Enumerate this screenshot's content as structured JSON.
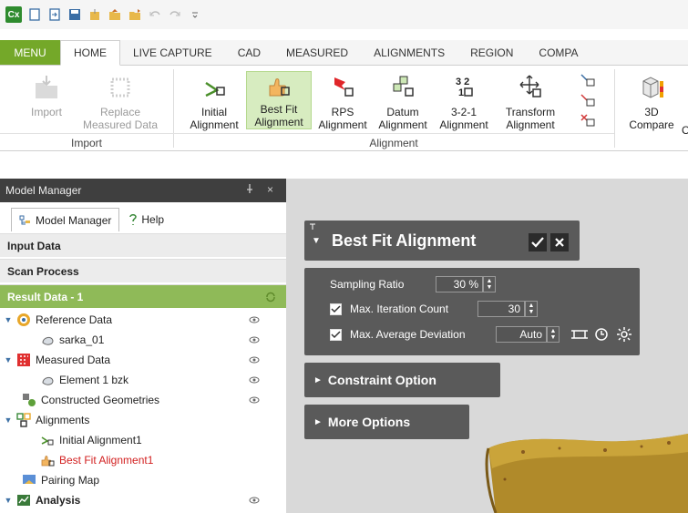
{
  "quick_access": {
    "logo": "Cx",
    "icons": [
      "new-icon",
      "import-icon",
      "save-icon",
      "export-icon",
      "open-icon",
      "open-folder-icon",
      "undo-icon",
      "redo-icon",
      "customize-icon"
    ]
  },
  "tabs": [
    {
      "label": "MENU"
    },
    {
      "label": "HOME"
    },
    {
      "label": "LIVE CAPTURE"
    },
    {
      "label": "CAD"
    },
    {
      "label": "MEASURED"
    },
    {
      "label": "ALIGNMENTS"
    },
    {
      "label": "REGION"
    },
    {
      "label": "COMPA"
    }
  ],
  "ribbon": {
    "import_group": "Import",
    "alignment_group": "Alignment",
    "buttons": {
      "import": "Import",
      "replace_1": "Replace",
      "replace_2": "Measured Data",
      "initial_1": "Initial",
      "initial_2": "Alignment",
      "bestfit_1": "Best Fit",
      "bestfit_2": "Alignment",
      "rps_1": "RPS",
      "rps_2": "Alignment",
      "datum_1": "Datum",
      "datum_2": "Alignment",
      "t321_1": "3-2-1",
      "t321_2": "Alignment",
      "transform_1": "Transform",
      "transform_2": "Alignment",
      "compare_1": "3D",
      "compare_2": "Compare",
      "compare_3": "C"
    }
  },
  "model_manager": {
    "title": "Model Manager",
    "pin": "\u0004",
    "close": "×",
    "tab_model": "Model Manager",
    "tab_help": "Help",
    "input_data": "Input Data",
    "scan_process": "Scan Process",
    "result_data": "Result Data - 1",
    "tree": {
      "reference_data": "Reference Data",
      "sarka": "sarka_01",
      "measured_data": "Measured Data",
      "element1": "Element 1 bzk",
      "constructed": "Constructed Geometries",
      "alignments": "Alignments",
      "initial_alignment": "Initial Alignment1",
      "best_fit_alignment": "Best Fit Alignment1",
      "pairing_map": "Pairing Map",
      "analysis": "Analysis"
    }
  },
  "best_fit_panel": {
    "title": "Best Fit Alignment",
    "sampling_ratio_label": "Sampling Ratio",
    "sampling_ratio_value": "30 %",
    "max_iteration_label": "Max. Iteration Count",
    "max_iteration_value": "30",
    "max_avg_dev_label": "Max. Average Deviation",
    "max_avg_dev_value": "Auto",
    "constraint_option": "Constraint Option",
    "more_options": "More Options"
  },
  "colors": {
    "accent_green": "#74a829",
    "result_green": "#8fba58",
    "panel_gray": "#5a5a5a",
    "title_dark": "#3f3f3f",
    "highlight_red": "#d21f1f"
  }
}
